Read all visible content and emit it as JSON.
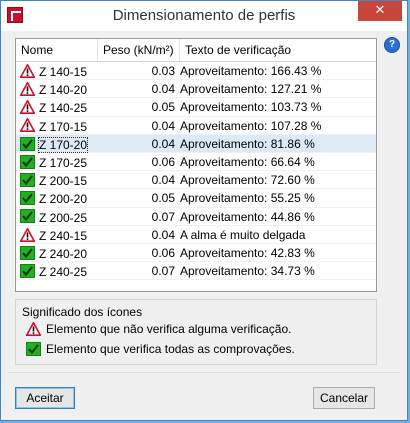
{
  "window": {
    "title": "Dimensionamento de perfis",
    "close_label": "✕"
  },
  "help": {
    "label": "?"
  },
  "table": {
    "headers": [
      "Nome",
      "Peso (kN/m²)",
      "Texto de verificação"
    ],
    "rows": [
      {
        "status": "warning",
        "name": "Z 140-15",
        "peso": "0.03",
        "texto": "Aproveitamento: 166.43 %"
      },
      {
        "status": "warning",
        "name": "Z 140-20",
        "peso": "0.04",
        "texto": "Aproveitamento: 127.21 %"
      },
      {
        "status": "warning",
        "name": "Z 140-25",
        "peso": "0.05",
        "texto": "Aproveitamento: 103.73 %"
      },
      {
        "status": "warning",
        "name": "Z 170-15",
        "peso": "0.04",
        "texto": "Aproveitamento: 107.28 %"
      },
      {
        "status": "ok",
        "name": "Z 170-20",
        "peso": "0.04",
        "texto": "Aproveitamento: 81.86 %",
        "selected": true
      },
      {
        "status": "ok",
        "name": "Z 170-25",
        "peso": "0.06",
        "texto": "Aproveitamento: 66.64 %"
      },
      {
        "status": "ok",
        "name": "Z 200-15",
        "peso": "0.04",
        "texto": "Aproveitamento: 72.60 %"
      },
      {
        "status": "ok",
        "name": "Z 200-20",
        "peso": "0.05",
        "texto": "Aproveitamento: 55.25 %"
      },
      {
        "status": "ok",
        "name": "Z 200-25",
        "peso": "0.07",
        "texto": "Aproveitamento: 44.86 %"
      },
      {
        "status": "warning",
        "name": "Z 240-15",
        "peso": "0.04",
        "texto": "A alma é muito delgada"
      },
      {
        "status": "ok",
        "name": "Z 240-20",
        "peso": "0.06",
        "texto": "Aproveitamento: 42.83 %"
      },
      {
        "status": "ok",
        "name": "Z 240-25",
        "peso": "0.07",
        "texto": "Aproveitamento: 34.73 %"
      }
    ]
  },
  "legend": {
    "title": "Significado dos ícones",
    "warning_text": "Elemento que não verifica alguma verificação.",
    "ok_text": "Elemento que verifica todas as comprovações."
  },
  "buttons": {
    "accept": "Aceitar",
    "cancel": "Cancelar"
  },
  "colors": {
    "warning_red": "#c8102e",
    "ok_green": "#22b022",
    "selection": "#ddeaf6"
  }
}
